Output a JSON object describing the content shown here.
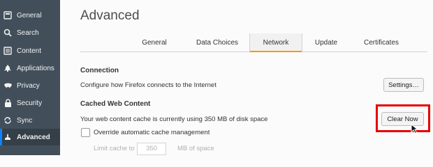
{
  "sidebar": {
    "items": [
      {
        "label": "General",
        "icon": "general-icon"
      },
      {
        "label": "Search",
        "icon": "search-icon"
      },
      {
        "label": "Content",
        "icon": "content-icon"
      },
      {
        "label": "Applications",
        "icon": "applications-icon"
      },
      {
        "label": "Privacy",
        "icon": "privacy-icon"
      },
      {
        "label": "Security",
        "icon": "security-icon"
      },
      {
        "label": "Sync",
        "icon": "sync-icon"
      },
      {
        "label": "Advanced",
        "icon": "advanced-icon",
        "active": true
      }
    ]
  },
  "main": {
    "title": "Advanced",
    "tabs": [
      {
        "label": "General"
      },
      {
        "label": "Data Choices"
      },
      {
        "label": "Network",
        "active": true
      },
      {
        "label": "Update"
      },
      {
        "label": "Certificates"
      }
    ],
    "connection": {
      "heading": "Connection",
      "description": "Configure how Firefox connects to the Internet",
      "settings_button": "Settings…"
    },
    "cache": {
      "heading": "Cached Web Content",
      "status": "Your web content cache is currently using 350 MB of disk space",
      "clear_button": "Clear Now",
      "override_label": "Override automatic cache management",
      "limit_prefix": "Limit cache to",
      "limit_value": "350",
      "limit_suffix": "MB of space"
    }
  },
  "colors": {
    "sidebar_bg": "#424f5a",
    "active_tab_accent": "#ff9500",
    "highlight_box": "#e60000"
  }
}
